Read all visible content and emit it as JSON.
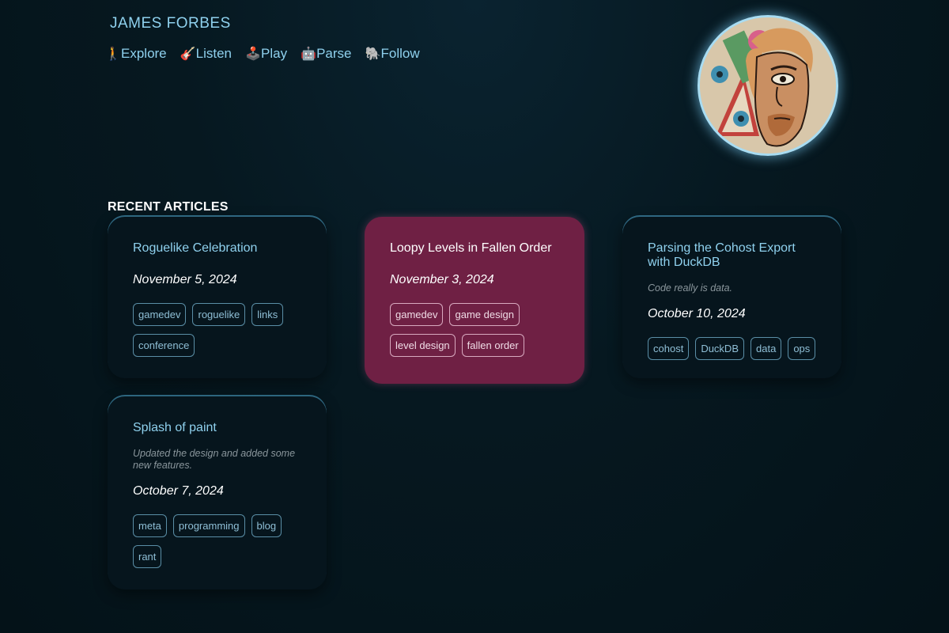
{
  "site": {
    "title": "JAMES FORBES"
  },
  "nav": [
    {
      "icon": "🚶",
      "label": "Explore"
    },
    {
      "icon": "🎸",
      "label": "Listen"
    },
    {
      "icon": "🕹️",
      "label": "Play"
    },
    {
      "icon": "🤖",
      "label": "Parse"
    },
    {
      "icon": "🐘",
      "label": " Follow"
    }
  ],
  "avatar": {
    "alt": "James Forbes portrait illustration"
  },
  "recent": {
    "heading": "RECENT ARTICLES",
    "articles": [
      {
        "title": "Roguelike Celebration",
        "description": "",
        "date": "November 5, 2024",
        "tags": [
          "gamedev",
          "roguelike",
          "links",
          "conference"
        ]
      },
      {
        "title": "Loopy Levels in Fallen Order",
        "description": "",
        "date": "November 3, 2024",
        "tags": [
          "gamedev",
          "game design",
          "level design",
          "fallen order"
        ],
        "highlighted": true
      },
      {
        "title": "Parsing the Cohost Export with DuckDB",
        "description": "Code really is data.",
        "date": "October 10, 2024",
        "tags": [
          "cohost",
          "DuckDB",
          "data",
          "ops"
        ]
      },
      {
        "title": "Splash of paint",
        "description": "Updated the design and added some new features.",
        "date": "October 7, 2024",
        "tags": [
          "meta",
          "programming",
          "blog",
          "rant"
        ]
      }
    ]
  },
  "colors": {
    "background": "#061820",
    "accent": "#8fd1ee",
    "highlight_card": "#6f2044"
  }
}
